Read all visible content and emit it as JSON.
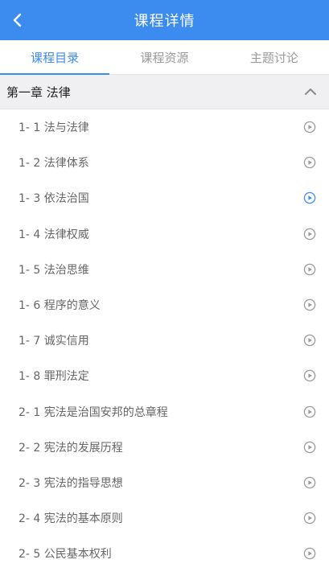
{
  "header": {
    "title": "课程详情",
    "back_icon": "chevron-left-icon"
  },
  "tabs": [
    {
      "label": "课程目录",
      "active": true
    },
    {
      "label": "课程资源",
      "active": false
    },
    {
      "label": "主题讨论",
      "active": false
    }
  ],
  "chapter": {
    "title": "第一章 法律",
    "expanded": true,
    "toggle_icon": "chevron-up-icon"
  },
  "lessons": [
    {
      "label": "1- 1 法与法律",
      "active": false
    },
    {
      "label": "1- 2 法律体系",
      "active": false
    },
    {
      "label": "1- 3 依法治国",
      "active": true
    },
    {
      "label": "1- 4 法律权威",
      "active": false
    },
    {
      "label": "1- 5 法治思维",
      "active": false
    },
    {
      "label": "1- 6 程序的意义",
      "active": false
    },
    {
      "label": "1- 7 诚实信用",
      "active": false
    },
    {
      "label": "1- 8 罪刑法定",
      "active": false
    },
    {
      "label": "2- 1 宪法是治国安邦的总章程",
      "active": false
    },
    {
      "label": "2- 2 宪法的发展历程",
      "active": false
    },
    {
      "label": "2- 3 宪法的指导思想",
      "active": false
    },
    {
      "label": "2- 4 宪法的基本原则",
      "active": false
    },
    {
      "label": "2- 5 公民基本权利",
      "active": false
    }
  ],
  "colors": {
    "accent": "#3c8cf0",
    "icon_inactive": "#9a9a9a"
  }
}
